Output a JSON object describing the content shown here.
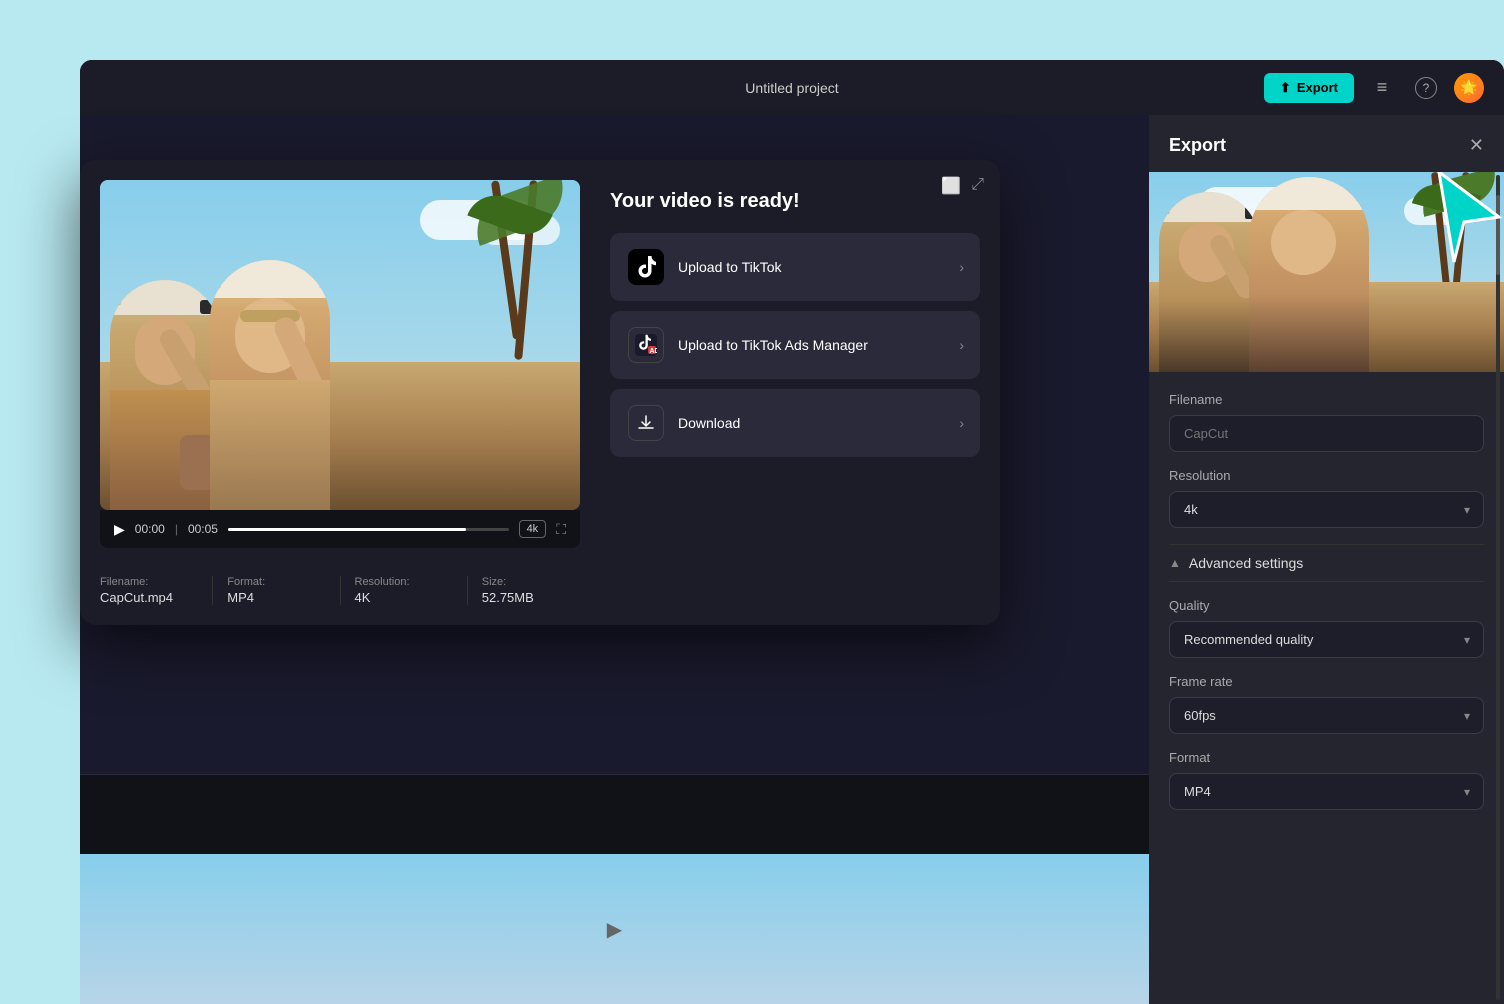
{
  "header": {
    "title": "Untitled project",
    "export_label": "Export",
    "icons": {
      "layers": "☰",
      "help": "?",
      "avatar": "🌟"
    }
  },
  "video_modal": {
    "ready_title": "Your video is ready!",
    "buttons": {
      "upload_tiktok": "Upload to TikTok",
      "upload_tiktok_ads": "Upload to TikTok Ads Manager",
      "download": "Download"
    },
    "player": {
      "current_time": "00:00",
      "total_time": "00:05",
      "quality": "4k"
    },
    "file_info": {
      "filename_label": "Filename:",
      "filename_value": "CapCut.mp4",
      "format_label": "Format:",
      "format_value": "MP4",
      "resolution_label": "Resolution:",
      "resolution_value": "4K",
      "size_label": "Size:",
      "size_value": "52.75MB"
    }
  },
  "export_panel": {
    "title": "Export",
    "filename_label": "Filename",
    "filename_placeholder": "CapCut",
    "resolution_label": "Resolution",
    "resolution_value": "4k",
    "advanced_settings_label": "Advanced settings",
    "quality_label": "Quality",
    "quality_value": "Recommended quality",
    "framerate_label": "Frame rate",
    "framerate_value": "60fps",
    "format_label": "Format",
    "format_value": "MP4"
  },
  "colors": {
    "accent": "#00d4c8",
    "bg_dark": "#1c1c28",
    "bg_panel": "#252530",
    "text_primary": "#ffffff",
    "text_secondary": "#aaaaaa"
  }
}
